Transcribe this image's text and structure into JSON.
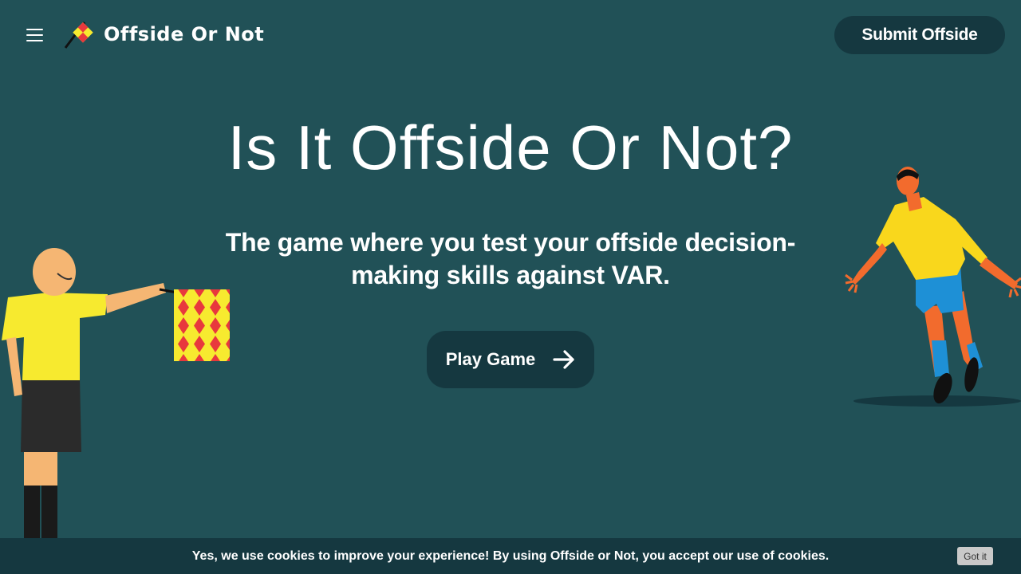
{
  "header": {
    "logo_text": "Offside Or Not",
    "submit_label": "Submit Offside"
  },
  "hero": {
    "title": "Is It Offside Or Not?",
    "subtitle": "The game where you test your offside decision-making skills against VAR.",
    "play_label": "Play Game"
  },
  "cookie": {
    "message": "Yes, we use cookies to improve your experience! By using Offside or Not, you accept our use of cookies.",
    "button_label": "Got it"
  },
  "colors": {
    "background": "#215157",
    "button_dark": "#153840",
    "flag_yellow": "#f7ea2f",
    "flag_red": "#e8383d",
    "kit_yellow": "#f9d71c",
    "kit_blue": "#1e90d6"
  },
  "icons": {
    "menu": "hamburger-menu-icon",
    "logo": "offside-flag-icon",
    "play": "arrow-right-icon"
  }
}
